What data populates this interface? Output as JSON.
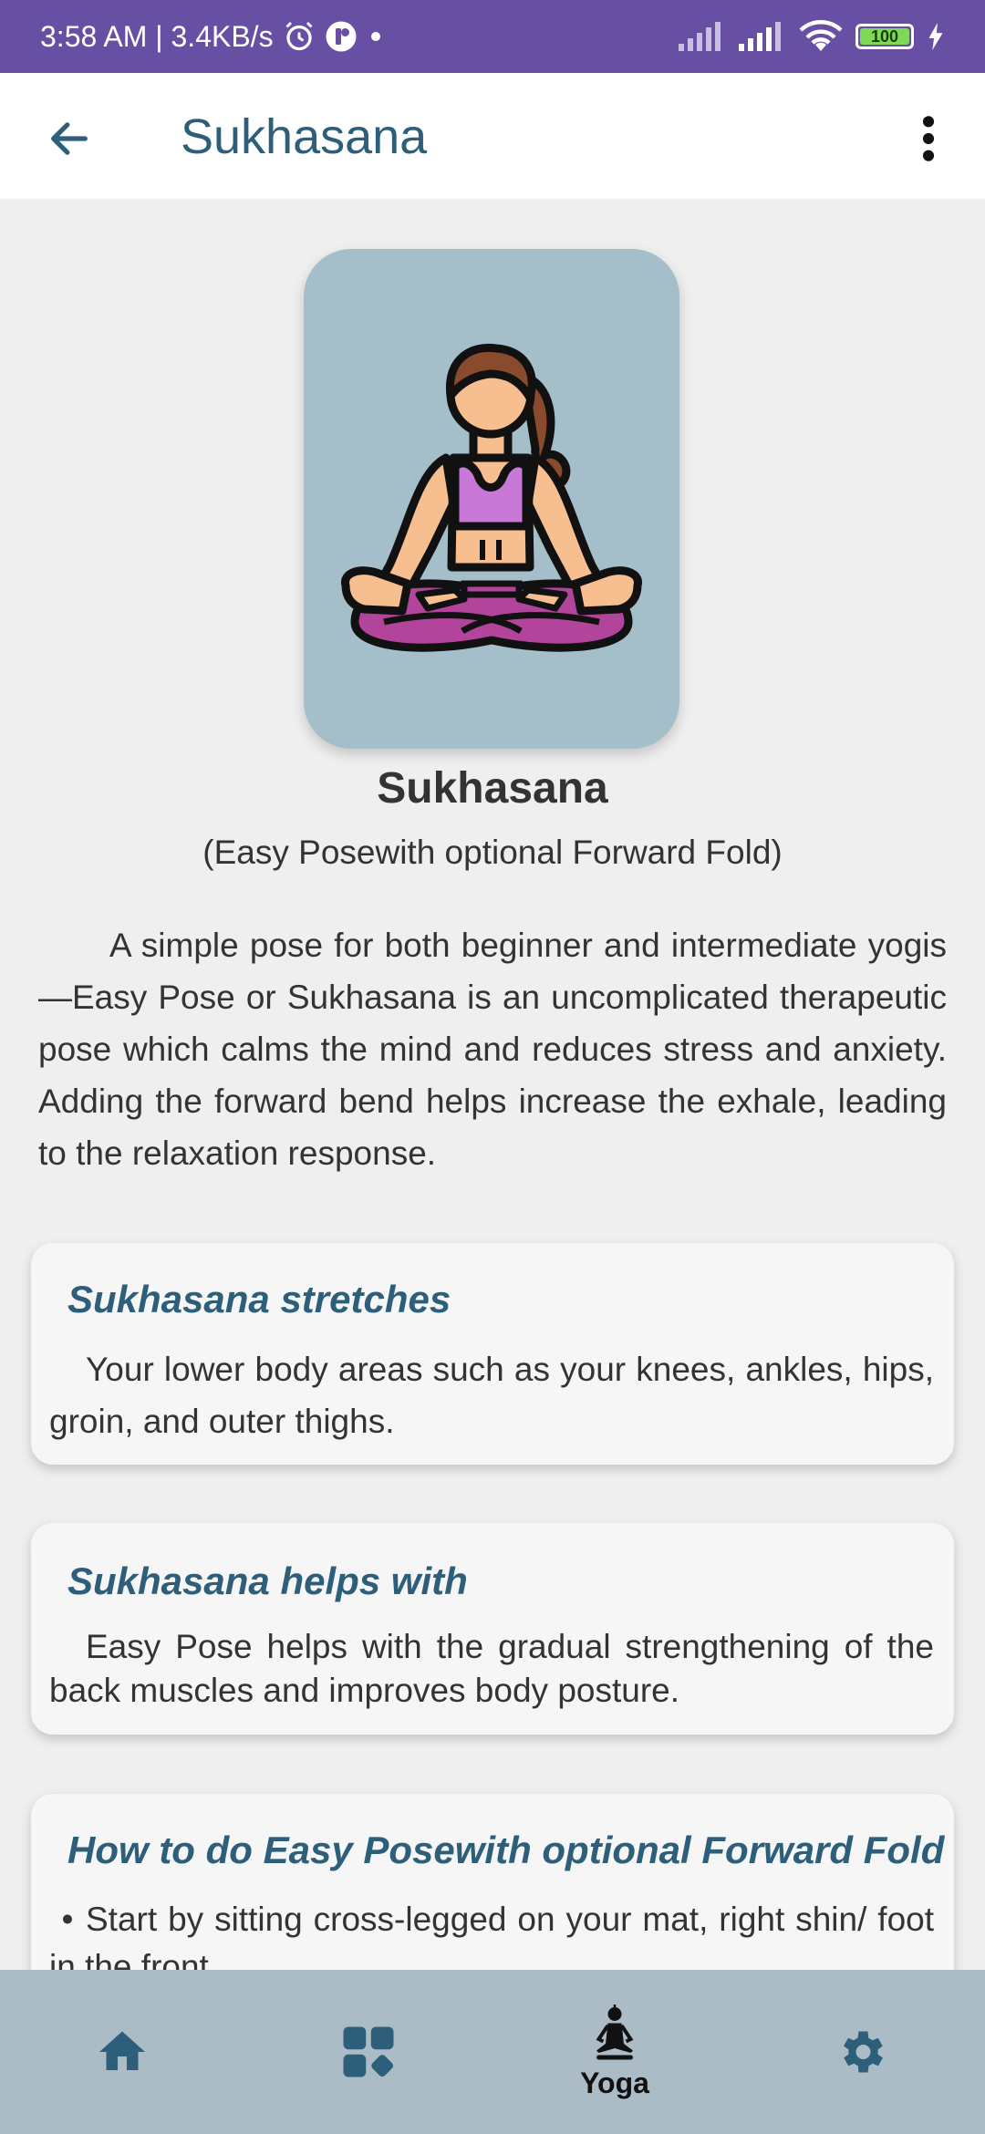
{
  "status_bar": {
    "time_speed": "3:58 AM | 3.4KB/s",
    "battery": "100"
  },
  "app_bar": {
    "title": "Sukhasana",
    "back_icon": "arrow-left-icon",
    "more_icon": "more-vert-icon"
  },
  "pose": {
    "image_icon": "meditation-pose-illustration",
    "name": "Sukhasana",
    "subtitle": "(Easy Posewith optional Forward Fold)",
    "description": "A simple pose for both beginner and intermediate yogis—Easy Pose or Sukhasana is an uncomplicated therapeutic pose which calms the mind and reduces stress and anxiety. Adding the forward bend helps increase the exhale, leading to the relaxation response."
  },
  "cards": [
    {
      "title": "Sukhasana stretches",
      "body": "Your lower body areas such as your knees, ankles, hips, groin, and outer thighs."
    },
    {
      "title": "Sukhasana helps with",
      "body": "Easy Pose helps with the gradual strengthening of the back muscles and improves body posture."
    },
    {
      "title": "How to do Easy Posewith optional Forward Fold",
      "bullet": "•",
      "body": "Start by sitting cross-legged on your mat, right shin/ foot in the front."
    }
  ],
  "bottom_nav": {
    "home_icon": "home-icon",
    "grid_icon": "dashboard-icon",
    "yoga_icon": "yoga-meditation-icon",
    "yoga_label": "Yoga",
    "settings_icon": "settings-gear-icon"
  },
  "colors": {
    "status_bar": "#6750a4",
    "accent": "#2e5f7a",
    "hero_bg": "#a4bfca",
    "nav_bg": "#acbcc7"
  }
}
